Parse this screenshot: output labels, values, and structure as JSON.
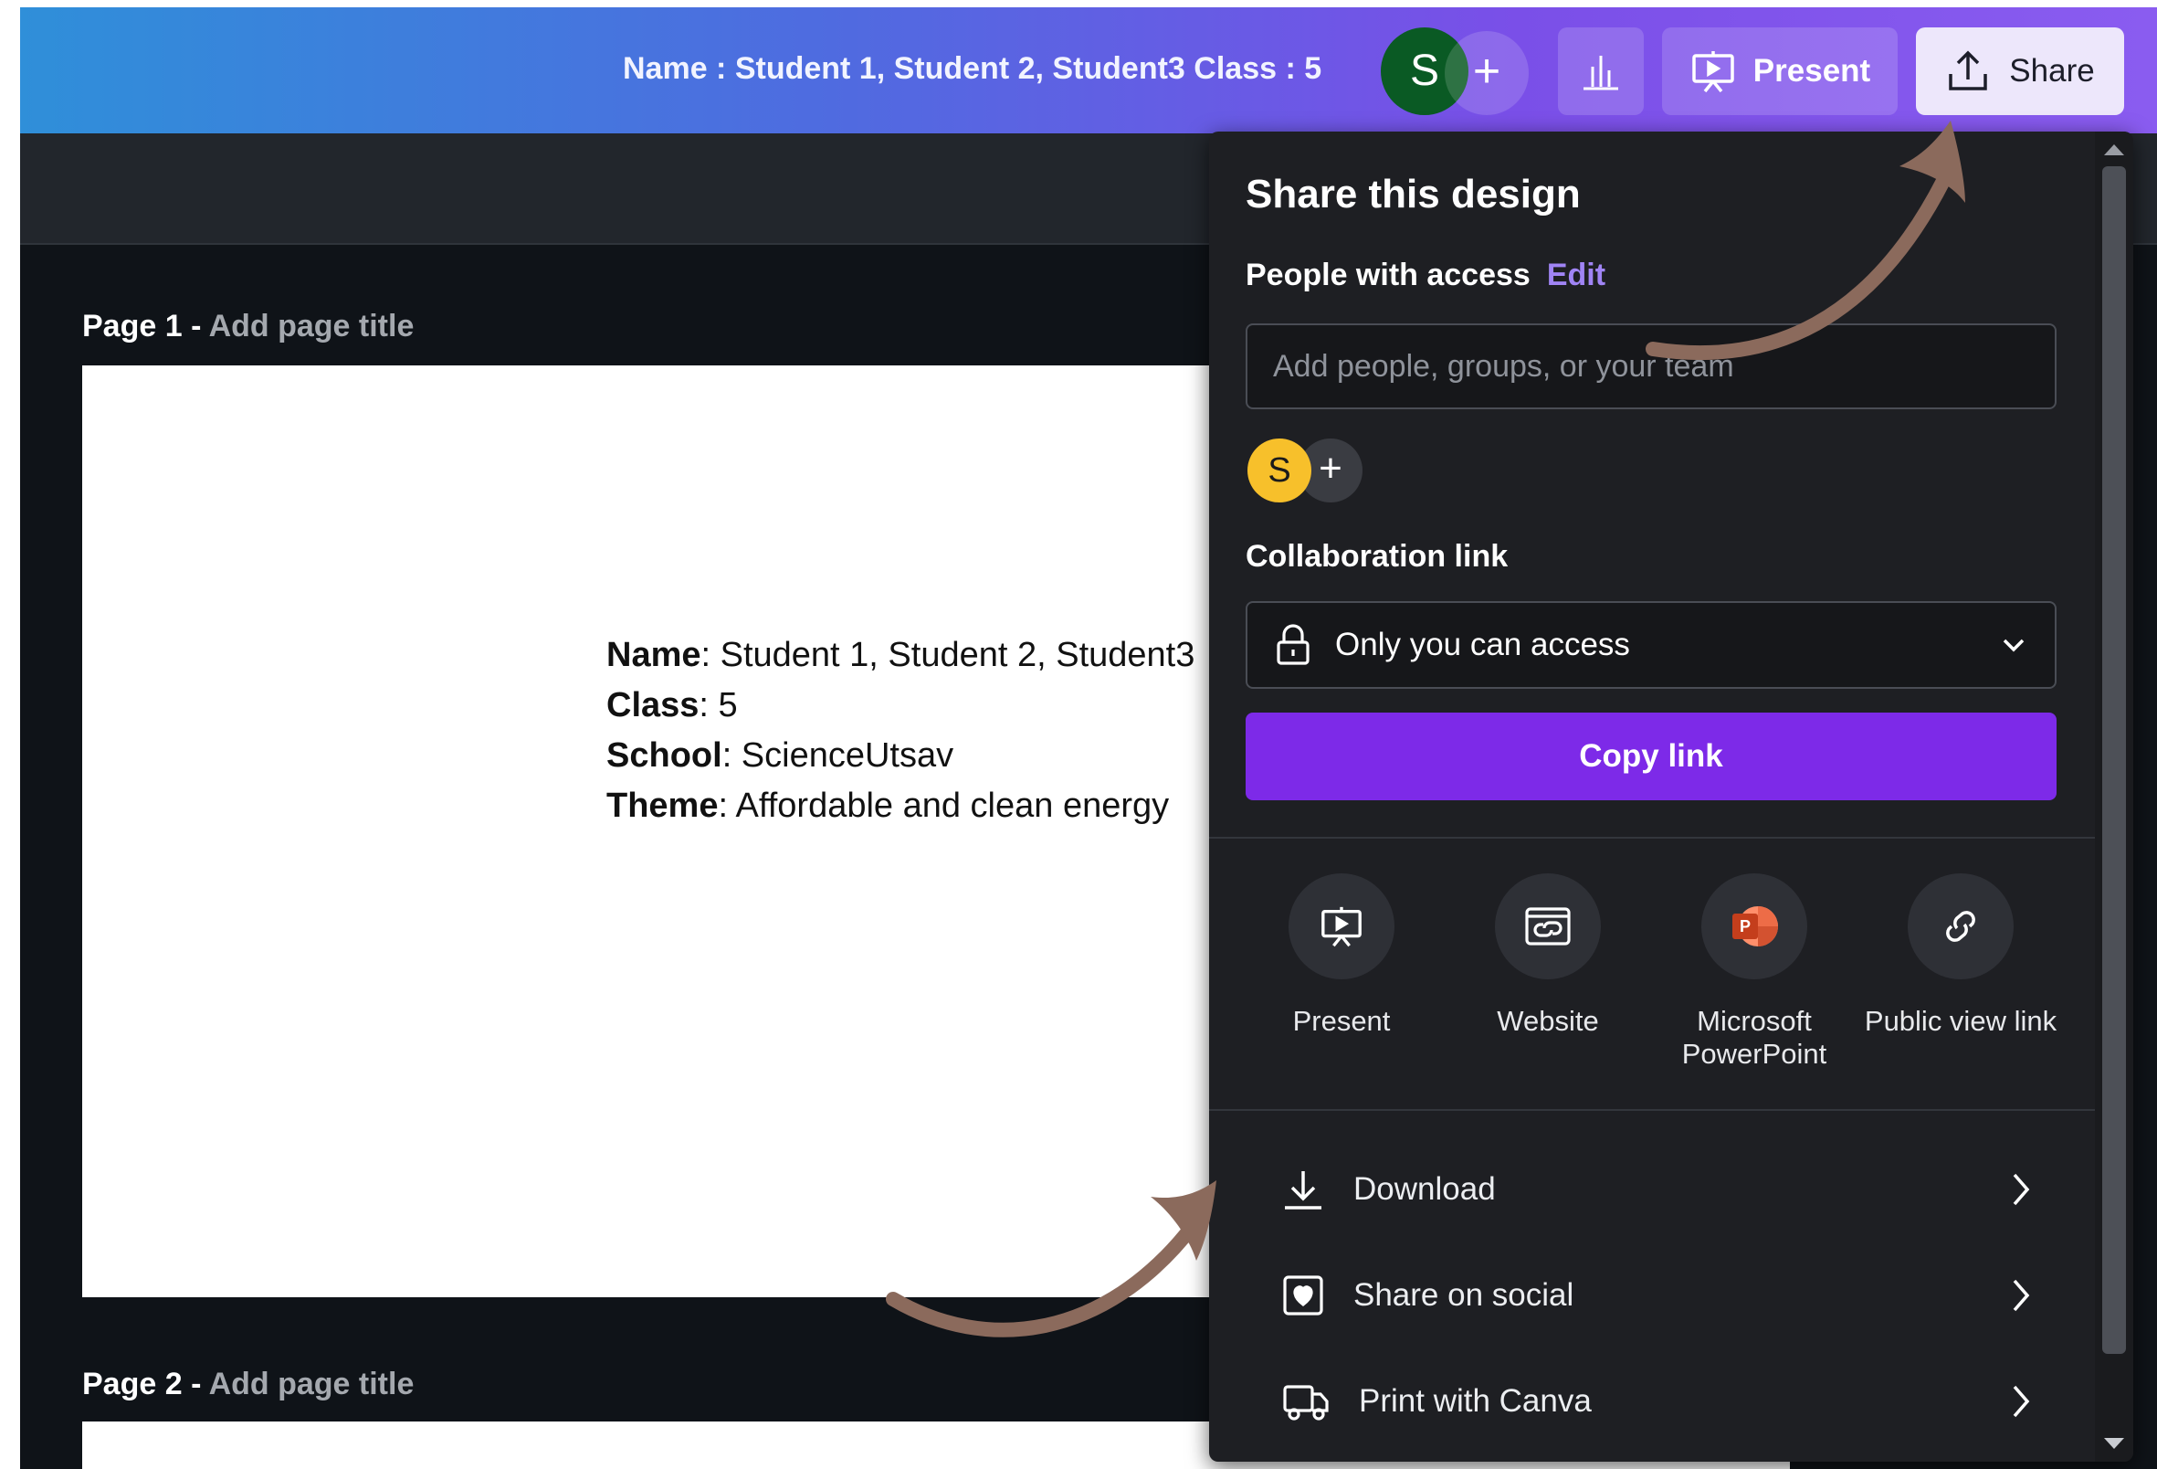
{
  "topbar": {
    "doc_title": "Name : Student 1, Student 2, Student3 Class : 5",
    "avatar_initial": "S",
    "add_symbol": "+",
    "present_label": "Present",
    "share_label": "Share"
  },
  "pages": [
    {
      "label": "Page 1 -",
      "title_placeholder": "Add page title"
    },
    {
      "label": "Page 2 -",
      "title_placeholder": "Add page title"
    }
  ],
  "slide": {
    "lines": [
      {
        "key": "Name",
        "value": ": Student 1, Student 2, Student3"
      },
      {
        "key": "Class",
        "value": ": 5"
      },
      {
        "key": "School",
        "value": ": ScienceUtsav"
      },
      {
        "key": "Theme",
        "value": ": Affordable and clean energy"
      }
    ]
  },
  "share_panel": {
    "title": "Share this design",
    "people_with_access": "People with access",
    "edit": "Edit",
    "people_input_placeholder": "Add people, groups, or your team",
    "member_initial": "S",
    "add_symbol": "+",
    "collab_label": "Collaboration link",
    "collab_value": "Only you can access",
    "copy_link": "Copy link",
    "options": [
      {
        "label": "Present",
        "icon": "present-icon"
      },
      {
        "label": "Website",
        "icon": "website-icon"
      },
      {
        "label": "Microsoft PowerPoint",
        "icon": "powerpoint-icon"
      },
      {
        "label": "Public view link",
        "icon": "link-icon"
      }
    ],
    "rows": [
      {
        "label": "Download",
        "icon": "download-icon"
      },
      {
        "label": "Share on social",
        "icon": "social-heart-icon"
      },
      {
        "label": "Print with Canva",
        "icon": "truck-icon"
      }
    ]
  },
  "colors": {
    "accent": "#7d2ae8",
    "annotation_arrow": "#8b6a5c",
    "panel_bg": "#1e1f23"
  }
}
